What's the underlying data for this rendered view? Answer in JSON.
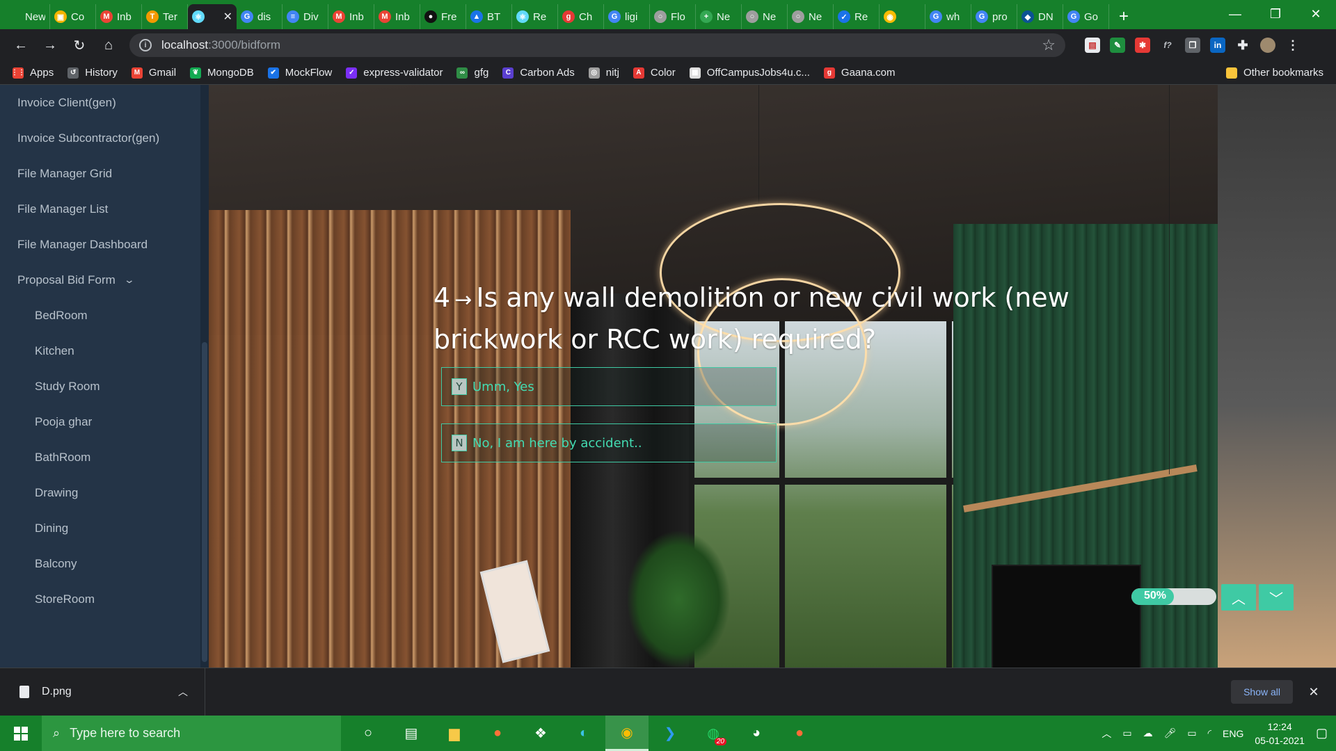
{
  "browser": {
    "tabs": [
      {
        "title": "New Ta",
        "fav_color": "#16802b",
        "fav_char": ""
      },
      {
        "title": "Co",
        "fav_color": "#f4b400",
        "fav_char": "▣"
      },
      {
        "title": "Inb",
        "fav_color": "#ea4335",
        "fav_char": "M"
      },
      {
        "title": "Ter",
        "fav_color": "#f29900",
        "fav_char": "T"
      },
      {
        "title": "",
        "fav_color": "#61dafb",
        "fav_char": "⚛",
        "active": true
      },
      {
        "title": "dis",
        "fav_color": "#4285f4",
        "fav_char": "G"
      },
      {
        "title": "Div",
        "fav_color": "#4285f4",
        "fav_char": "≡"
      },
      {
        "title": "Inb",
        "fav_color": "#ea4335",
        "fav_char": "M"
      },
      {
        "title": "Inb",
        "fav_color": "#ea4335",
        "fav_char": "M"
      },
      {
        "title": "Fre",
        "fav_color": "#111111",
        "fav_char": "●"
      },
      {
        "title": "BT",
        "fav_color": "#1a73e8",
        "fav_char": "▲"
      },
      {
        "title": "Re",
        "fav_color": "#61dafb",
        "fav_char": "⚛"
      },
      {
        "title": "Ch",
        "fav_color": "#e53935",
        "fav_char": "g"
      },
      {
        "title": "ligi",
        "fav_color": "#4285f4",
        "fav_char": "G"
      },
      {
        "title": "Flo",
        "fav_color": "#9e9e9e",
        "fav_char": "○"
      },
      {
        "title": "Ne",
        "fav_color": "#34a853",
        "fav_char": "+"
      },
      {
        "title": "Ne",
        "fav_color": "#9e9e9e",
        "fav_char": "○"
      },
      {
        "title": "Ne",
        "fav_color": "#9e9e9e",
        "fav_char": "○"
      },
      {
        "title": "Re",
        "fav_color": "#1a73e8",
        "fav_char": "✓"
      },
      {
        "title": "",
        "fav_color": "#fbbc04",
        "fav_char": "◉"
      },
      {
        "title": "wh",
        "fav_color": "#4285f4",
        "fav_char": "G"
      },
      {
        "title": "pro",
        "fav_color": "#4285f4",
        "fav_char": "G"
      },
      {
        "title": "DN",
        "fav_color": "#0b5394",
        "fav_char": "◆"
      },
      {
        "title": "Go",
        "fav_color": "#4285f4",
        "fav_char": "G"
      }
    ],
    "new_tab": "+",
    "window_controls": {
      "minimize": "—",
      "maximize": "❐",
      "close": "✕"
    },
    "nav": {
      "back": "←",
      "forward": "→",
      "reload": "↻",
      "home": "⌂"
    },
    "url": {
      "host": "localhost",
      "path": ":3000/bidform"
    },
    "bookmarks": [
      {
        "label": "Apps",
        "color": "#ea4335",
        "char": "⋮⋮"
      },
      {
        "label": "History",
        "color": "#5f6368",
        "char": "↺"
      },
      {
        "label": "Gmail",
        "color": "#ea4335",
        "char": "M"
      },
      {
        "label": "MongoDB",
        "color": "#13aa52",
        "char": "❦"
      },
      {
        "label": "MockFlow",
        "color": "#1a73e8",
        "char": "✔"
      },
      {
        "label": "express-validator",
        "color": "#7b2ff7",
        "char": "✓"
      },
      {
        "label": "gfg",
        "color": "#2f8d46",
        "char": "∞"
      },
      {
        "label": "Carbon Ads",
        "color": "#5a3fd0",
        "char": "C"
      },
      {
        "label": "nitj",
        "color": "#9e9e9e",
        "char": "◎"
      },
      {
        "label": "Color",
        "color": "#e53935",
        "char": "A"
      },
      {
        "label": "OffCampusJobs4u.c...",
        "color": "#dddddd",
        "char": "▦"
      },
      {
        "label": "Gaana.com",
        "color": "#e53935",
        "char": "g"
      }
    ],
    "other_bookmarks": "Other bookmarks"
  },
  "sidebar": {
    "items": [
      {
        "label": "Invoice Client(gen)",
        "sub": false
      },
      {
        "label": "Invoice Subcontractor(gen)",
        "sub": false
      },
      {
        "label": "File Manager Grid",
        "sub": false
      },
      {
        "label": "File Manager List",
        "sub": false
      },
      {
        "label": "File Manager Dashboard",
        "sub": false
      },
      {
        "label": "Proposal Bid Form",
        "sub": false,
        "expanded": true
      },
      {
        "label": "BedRoom",
        "sub": true
      },
      {
        "label": "Kitchen",
        "sub": true
      },
      {
        "label": "Study Room",
        "sub": true
      },
      {
        "label": "Pooja ghar",
        "sub": true
      },
      {
        "label": "BathRoom",
        "sub": true
      },
      {
        "label": "Drawing",
        "sub": true
      },
      {
        "label": "Dining",
        "sub": true
      },
      {
        "label": "Balcony",
        "sub": true
      },
      {
        "label": "StoreRoom",
        "sub": true
      }
    ]
  },
  "form": {
    "question_number": "4",
    "question_arrow": "→",
    "question_text": "Is any wall demolition or new civil work (new brickwork or RCC work) required?",
    "choices": [
      {
        "key": "Y",
        "label": "Umm, Yes"
      },
      {
        "key": "N",
        "label": "No, I am here by accident.."
      }
    ],
    "progress_label": "50%",
    "progress_fraction": 0.5,
    "accent_color": "#3fcaa4"
  },
  "downloads": {
    "file": "D.png",
    "show_all": "Show all"
  },
  "taskbar": {
    "search_placeholder": "Type here to search",
    "whatsapp_badge": "20",
    "language": "ENG",
    "time": "12:24",
    "date": "05-01-2021"
  }
}
